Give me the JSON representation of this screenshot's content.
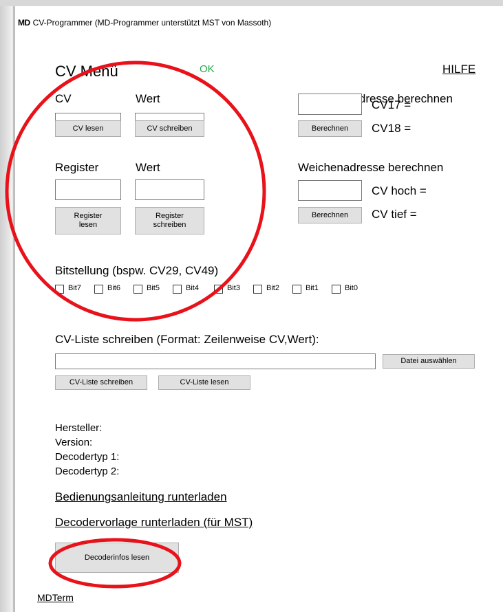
{
  "window": {
    "logo": "MD",
    "title": "CV-Programmer (MD-Programmer unterstützt MST von Massoth)"
  },
  "header": {
    "title": "CV Menü",
    "status": "OK",
    "help_link": "HILFE"
  },
  "cv_section": {
    "cv_label": "CV",
    "value_label": "Wert",
    "cv_value": "",
    "wert_value": "",
    "read_button": "CV lesen",
    "write_button": "CV schreiben"
  },
  "register_section": {
    "register_label": "Register",
    "value_label": "Wert",
    "register_value": "",
    "wert_value": "",
    "read_button_line1": "Register",
    "read_button_line2": "lesen",
    "write_button_line1": "Register",
    "write_button_line2": "schreiben"
  },
  "long_address": {
    "title": "Lange Lokadresse berechnen",
    "input_value": "",
    "cv17_label": "CV17 =",
    "cv18_label": "CV18 =",
    "calc_button": "Berechnen"
  },
  "switch_address": {
    "title": "Weichenadresse berechnen",
    "input_value": "",
    "cv_high_label": "CV hoch =",
    "cv_low_label": "CV tief =",
    "calc_button": "Berechnen"
  },
  "bits": {
    "title": "Bitstellung (bspw. CV29, CV49)",
    "items": [
      {
        "label": "Bit7",
        "checked": false
      },
      {
        "label": "Bit6",
        "checked": false
      },
      {
        "label": "Bit5",
        "checked": false
      },
      {
        "label": "Bit4",
        "checked": false
      },
      {
        "label": "Bit3",
        "checked": false
      },
      {
        "label": "Bit2",
        "checked": false
      },
      {
        "label": "Bit1",
        "checked": false
      },
      {
        "label": "Bit0",
        "checked": false
      }
    ]
  },
  "cv_list": {
    "title": "CV-Liste schreiben (Format: Zeilenweise CV,Wert):",
    "file_value": "",
    "choose_file_button": "Datei auswählen",
    "write_button": "CV-Liste schreiben",
    "read_button": "CV-Liste lesen"
  },
  "decoder_info": {
    "manufacturer_label": "Hersteller:",
    "version_label": "Version:",
    "decoder_type1_label": "Decodertyp 1:",
    "decoder_type2_label": "Decodertyp 2:",
    "manual_link": "Bedienungsanleitung runterladen",
    "template_link": "Decodervorlage runterladen (für MST)",
    "read_button": "Decoderinfos lesen"
  },
  "footer": {
    "mdterm_link": "MDTerm"
  },
  "colors": {
    "status_ok": "#1fa94a",
    "annotation": "#e8121b",
    "button_bg": "#e1e1e1",
    "button_border": "#adadad"
  }
}
